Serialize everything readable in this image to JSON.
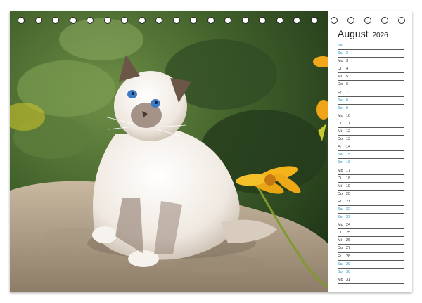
{
  "calendar": {
    "month": "August",
    "year": "2026",
    "weekend_color": "#2a96c8",
    "days": [
      {
        "weekday": "Sa",
        "day": "1",
        "weekend": true
      },
      {
        "weekday": "So",
        "day": "2",
        "weekend": true
      },
      {
        "weekday": "Mo",
        "day": "3",
        "weekend": false
      },
      {
        "weekday": "Di",
        "day": "4",
        "weekend": false
      },
      {
        "weekday": "Mi",
        "day": "5",
        "weekend": false
      },
      {
        "weekday": "Do",
        "day": "6",
        "weekend": false
      },
      {
        "weekday": "Fr",
        "day": "7",
        "weekend": false
      },
      {
        "weekday": "Sa",
        "day": "8",
        "weekend": true
      },
      {
        "weekday": "So",
        "day": "9",
        "weekend": true
      },
      {
        "weekday": "Mo",
        "day": "10",
        "weekend": false
      },
      {
        "weekday": "Di",
        "day": "11",
        "weekend": false
      },
      {
        "weekday": "Mi",
        "day": "12",
        "weekend": false
      },
      {
        "weekday": "Do",
        "day": "13",
        "weekend": false
      },
      {
        "weekday": "Fr",
        "day": "14",
        "weekend": false
      },
      {
        "weekday": "Sa",
        "day": "15",
        "weekend": true
      },
      {
        "weekday": "So",
        "day": "16",
        "weekend": true
      },
      {
        "weekday": "Mo",
        "day": "17",
        "weekend": false
      },
      {
        "weekday": "Di",
        "day": "18",
        "weekend": false
      },
      {
        "weekday": "Mi",
        "day": "19",
        "weekend": false
      },
      {
        "weekday": "Do",
        "day": "20",
        "weekend": false
      },
      {
        "weekday": "Fr",
        "day": "21",
        "weekend": false
      },
      {
        "weekday": "Sa",
        "day": "22",
        "weekend": true
      },
      {
        "weekday": "So",
        "day": "23",
        "weekend": true
      },
      {
        "weekday": "Mo",
        "day": "24",
        "weekend": false
      },
      {
        "weekday": "Di",
        "day": "25",
        "weekend": false
      },
      {
        "weekday": "Mi",
        "day": "26",
        "weekend": false
      },
      {
        "weekday": "Do",
        "day": "27",
        "weekend": false
      },
      {
        "weekday": "Fr",
        "day": "28",
        "weekend": false
      },
      {
        "weekday": "Sa",
        "day": "29",
        "weekend": true
      },
      {
        "weekday": "So",
        "day": "30",
        "weekend": true
      },
      {
        "weekday": "Mo",
        "day": "31",
        "weekend": false
      }
    ]
  }
}
